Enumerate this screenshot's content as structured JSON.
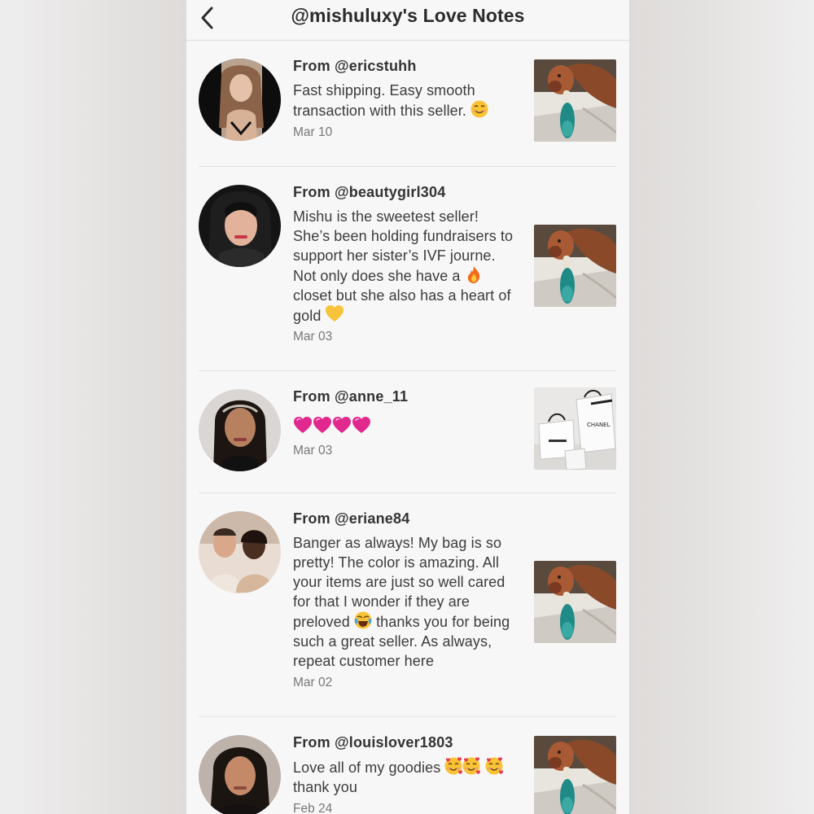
{
  "header": {
    "title": "@mishuluxy's Love Notes",
    "back_icon": "chevron-left-icon"
  },
  "notes": [
    {
      "from": "From @ericstuhh",
      "message": "Fast shipping. Easy smooth transaction with this seller.",
      "emojis": [
        "smiling-face-emoji"
      ],
      "date": "Mar 10",
      "thumb": "dog-photo"
    },
    {
      "from": "From @beautygirl304",
      "message_parts": [
        "Mishu is the sweetest seller! She’s been holding fundraisers to support her sister’s IVF journe. Not only does she have a",
        "closet but she also has a heart of gold"
      ],
      "emojis": [
        "fire-emoji",
        "yellow-heart-emoji"
      ],
      "date": "Mar 03",
      "thumb": "dog-photo"
    },
    {
      "from": "From @anne_11",
      "message": "",
      "emojis": [
        "pink-heart-emoji",
        "pink-heart-emoji",
        "pink-heart-emoji",
        "pink-heart-emoji"
      ],
      "date": "Mar 03",
      "thumb": "shopping-bags-photo"
    },
    {
      "from": "From @eriane84",
      "message_parts": [
        "Banger as always! My bag is so pretty! The color is amazing. All your items are just so well cared for that I wonder if they are preloved",
        "thanks you for being such a great seller. As always, repeat customer here"
      ],
      "emojis": [
        "tears-of-joy-emoji"
      ],
      "date": "Mar 02",
      "thumb": "dog-photo"
    },
    {
      "from": "From @louislover1803",
      "message_parts": [
        "Love all of my goodies",
        "thank you"
      ],
      "emojis": [
        "smiling-face-with-hearts-emoji",
        "smiling-face-with-hearts-emoji",
        "smiling-face-with-hearts-emoji"
      ],
      "date": "Feb 24",
      "thumb": "dog-photo"
    }
  ],
  "colors": {
    "panel_bg": "#f8f7f8",
    "text": "#3c3c3c",
    "date": "#777777",
    "separator": "#e6e5e5",
    "pink_heart": "#e0288f",
    "yellow_heart": "#f6c33a"
  }
}
